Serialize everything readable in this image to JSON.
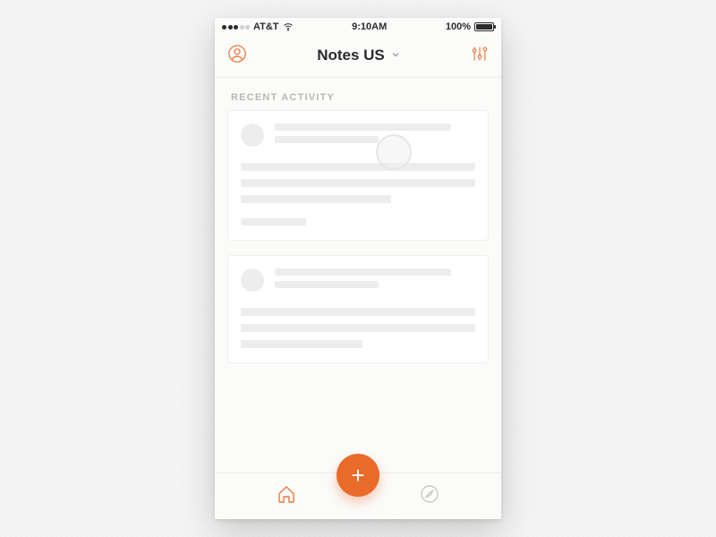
{
  "statusbar": {
    "carrier": "AT&T",
    "signal_filled": 3,
    "signal_total": 5,
    "time": "9:10AM",
    "battery_pct": "100%"
  },
  "header": {
    "title": "Notes US"
  },
  "section": {
    "label": "RECENT ACTIVITY"
  },
  "fab": {
    "glyph": "+"
  },
  "colors": {
    "accent": "#ea6a2a",
    "accent_light": "#e77a3f"
  }
}
